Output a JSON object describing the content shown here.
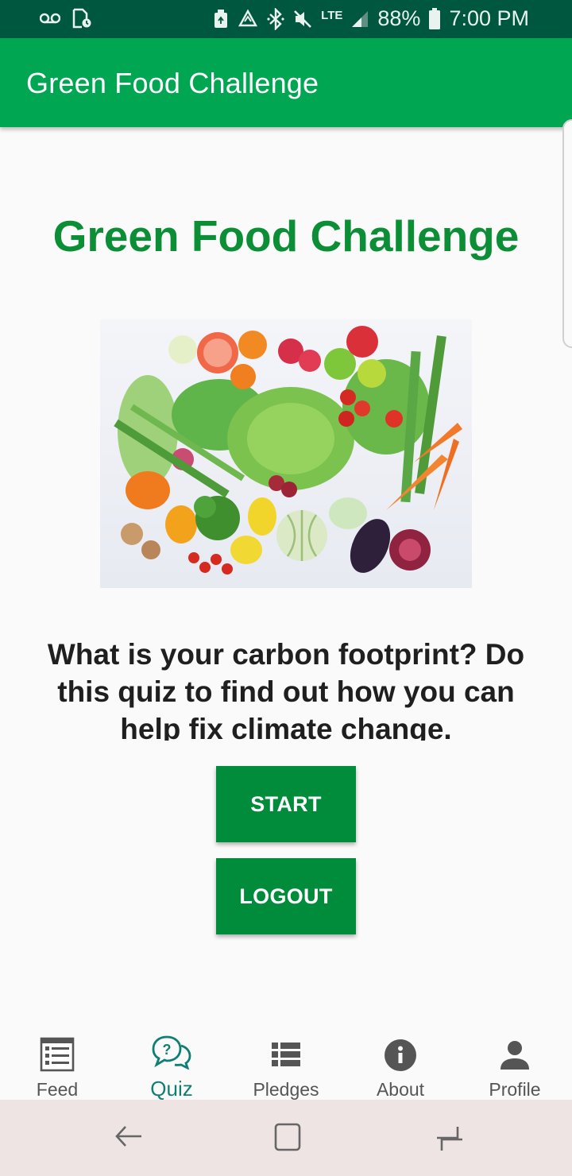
{
  "status_bar": {
    "battery": "88%",
    "time": "7:00 PM",
    "network": "LTE",
    "icons": [
      "voicemail-icon",
      "sim-icon",
      "nfc-icon",
      "sync-icon",
      "bluetooth-icon",
      "mute-icon",
      "signal-icon",
      "battery-icon"
    ]
  },
  "app_bar": {
    "title": "Green Food Challenge"
  },
  "main": {
    "heading": "Green Food Challenge",
    "hero_image": "vegetables-image",
    "intro": "What is your carbon footprint? Do this quiz to find out how you can help fix climate change.",
    "start_label": "START",
    "logout_label": "LOGOUT"
  },
  "bottom_nav": {
    "active": "Quiz",
    "items": [
      {
        "label": "Feed",
        "icon": "feed-icon"
      },
      {
        "label": "Quiz",
        "icon": "quiz-icon"
      },
      {
        "label": "Pledges",
        "icon": "pledges-icon"
      },
      {
        "label": "About",
        "icon": "info-icon"
      },
      {
        "label": "Profile",
        "icon": "profile-icon"
      }
    ]
  },
  "system_nav": {
    "icons": [
      "back-icon",
      "home-icon",
      "recents-icon"
    ]
  },
  "colors": {
    "status_bar": "#00573f",
    "app_bar": "#00a651",
    "heading": "#0b8e35",
    "button": "#008c3a",
    "active_tab": "#0f7f74"
  }
}
